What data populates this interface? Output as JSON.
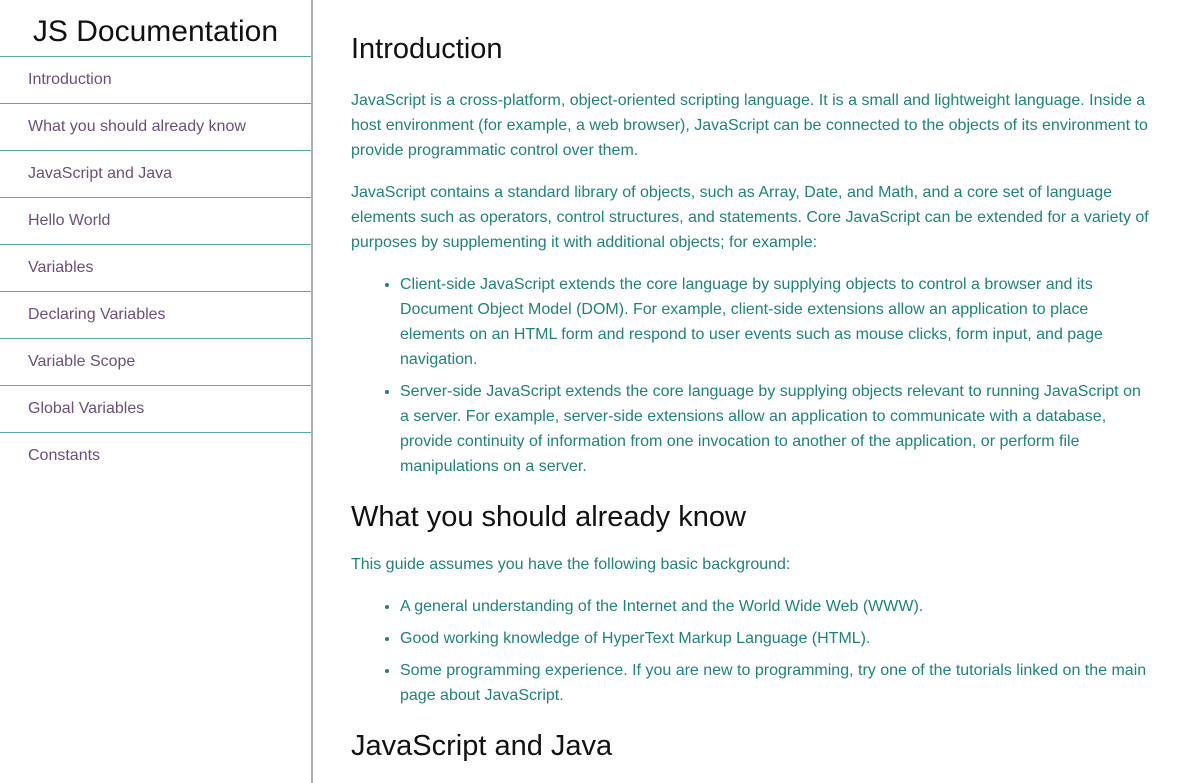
{
  "navbar": {
    "title": "JS Documentation",
    "items": [
      {
        "label": "Introduction"
      },
      {
        "label": "What you should already know"
      },
      {
        "label": "JavaScript and Java"
      },
      {
        "label": "Hello World"
      },
      {
        "label": "Variables"
      },
      {
        "label": "Declaring Variables"
      },
      {
        "label": "Variable Scope"
      },
      {
        "label": "Global Variables"
      },
      {
        "label": "Constants"
      }
    ]
  },
  "sections": {
    "introduction": {
      "title": "Introduction",
      "paragraphs": [
        "JavaScript is a cross-platform, object-oriented scripting language. It is a small and lightweight language. Inside a host environment (for example, a web browser), JavaScript can be connected to the objects of its environment to provide programmatic control over them.",
        "JavaScript contains a standard library of objects, such as Array, Date, and Math, and a core set of language elements such as operators, control structures, and statements. Core JavaScript can be extended for a variety of purposes by supplementing it with additional objects; for example:"
      ],
      "bullets": [
        "Client-side JavaScript extends the core language by supplying objects to control a browser and its Document Object Model (DOM). For example, client-side extensions allow an application to place elements on an HTML form and respond to user events such as mouse clicks, form input, and page navigation.",
        "Server-side JavaScript extends the core language by supplying objects relevant to running JavaScript on a server. For example, server-side extensions allow an application to communicate with a database, provide continuity of information from one invocation to another of the application, or perform file manipulations on a server."
      ]
    },
    "what_you_should_know": {
      "title": "What you should already know",
      "paragraphs": [
        "This guide assumes you have the following basic background:"
      ],
      "bullets": [
        "A general understanding of the Internet and the World Wide Web (WWW).",
        "Good working knowledge of HyperText Markup Language (HTML).",
        "Some programming experience. If you are new to programming, try one of the tutorials linked on the main page about JavaScript."
      ]
    },
    "javascript_and_java": {
      "title": "JavaScript and Java"
    }
  },
  "colors": {
    "link": "#6b4f7c",
    "body_text": "#1f827c",
    "divider": "#5ba9a4",
    "sidebar_border": "#a9b1b1",
    "heading": "#111111"
  }
}
